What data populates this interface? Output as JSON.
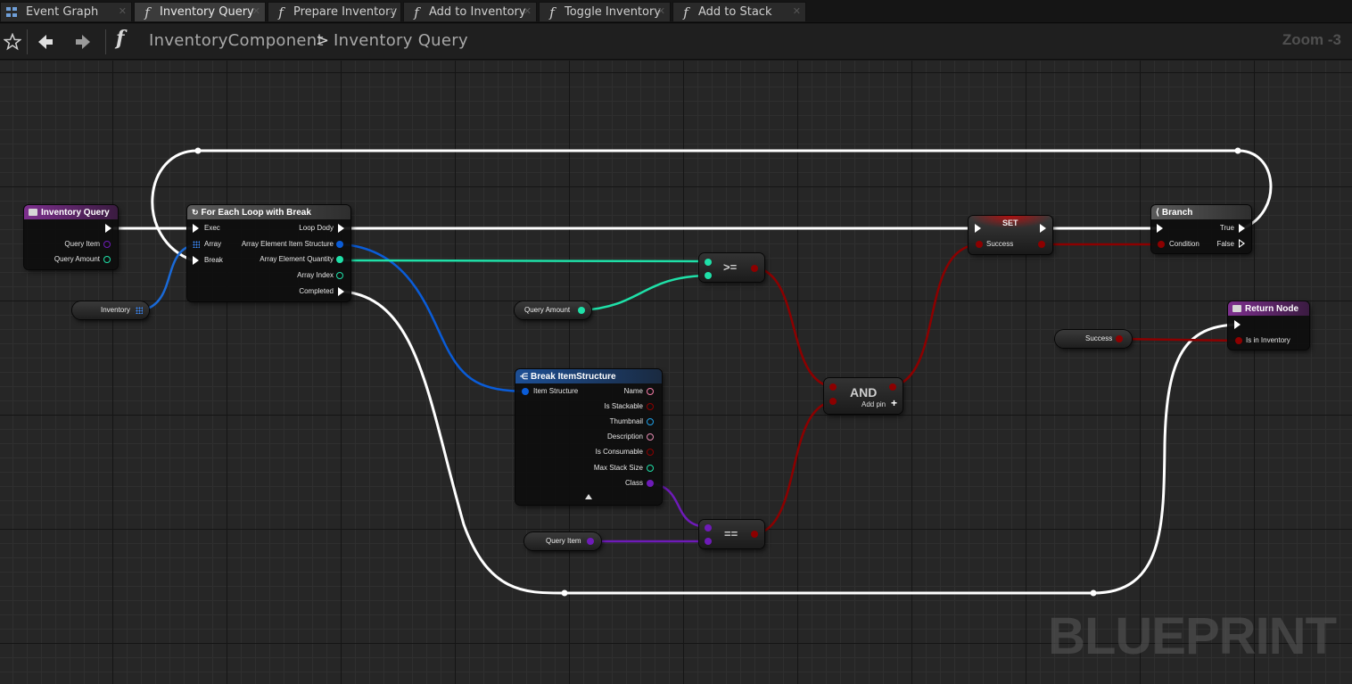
{
  "tabs": [
    {
      "label": "Event Graph",
      "icon": "event-graph-icon",
      "active": false
    },
    {
      "label": "Inventory Query",
      "icon": "function-icon",
      "active": true
    },
    {
      "label": "Prepare Inventory",
      "icon": "function-icon",
      "active": false
    },
    {
      "label": "Add to Inventory",
      "icon": "function-icon",
      "active": false
    },
    {
      "label": "Toggle Inventory",
      "icon": "function-icon",
      "active": false
    },
    {
      "label": "Add to Stack",
      "icon": "function-icon",
      "active": false
    }
  ],
  "header": {
    "breadcrumb_parent": "InventoryComponent",
    "breadcrumb_sep": ">",
    "breadcrumb_current": "Inventory Query",
    "zoom": "Zoom -3",
    "function_glyph": "f"
  },
  "nodes": {
    "entry": {
      "title": "Inventory Query",
      "pins": [
        "Query Item",
        "Query Amount"
      ]
    },
    "foreach": {
      "title": "For Each Loop with Break",
      "in_pins": [
        "Exec",
        "Array",
        "Break"
      ],
      "out_pins": [
        "Loop Dody",
        "Array Element Item Structure",
        "Array Element Quantity",
        "Array Index",
        "Completed"
      ]
    },
    "inventory_get": {
      "label": "Inventory"
    },
    "query_amount_get": {
      "label": "Query Amount"
    },
    "query_item_get": {
      "label": "Query Item"
    },
    "gte": {
      "label": ">="
    },
    "eq": {
      "label": "=="
    },
    "and": {
      "label": "AND",
      "add_pin": "Add pin"
    },
    "break": {
      "title": "Break ItemStructure",
      "in_pin": "Item Structure",
      "out_pins": [
        "Name",
        "Is Stackable",
        "Thumbnail",
        "Description",
        "Is Consumable",
        "Max Stack Size",
        "Class"
      ]
    },
    "set": {
      "title": "SET",
      "pin": "Success"
    },
    "branch": {
      "title": "Branch",
      "in_pin": "Condition",
      "out_true": "True",
      "out_false": "False"
    },
    "success_get": {
      "label": "Success"
    },
    "return": {
      "title": "Return Node",
      "pin": "Is in Inventory"
    }
  },
  "watermark": "BLUEPRINT",
  "colors": {
    "exec": "#ffffff",
    "bool": "#8c0000",
    "int": "#1fe0a8",
    "struct": "#0a5cd8",
    "class": "#6e1bb8",
    "array": "#1a6ad8"
  }
}
